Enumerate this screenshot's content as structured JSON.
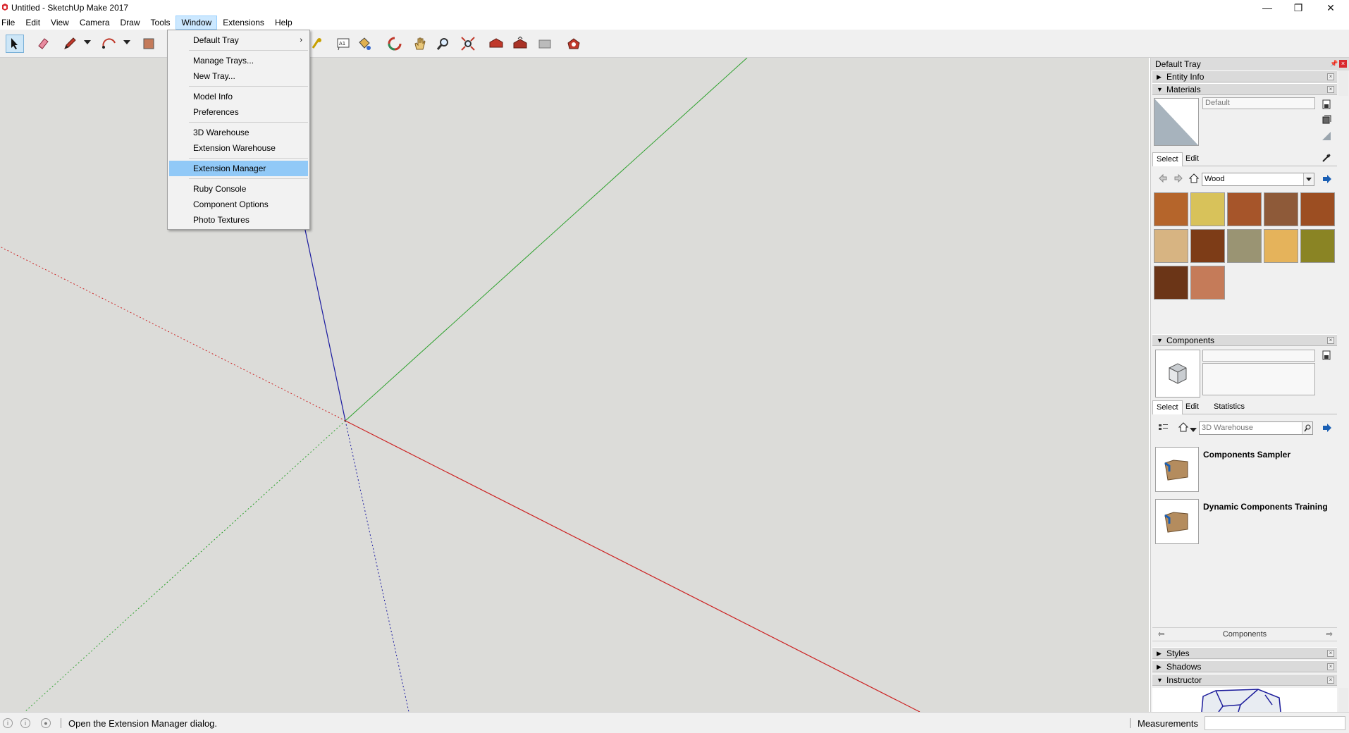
{
  "window": {
    "title": "Untitled - SketchUp Make 2017",
    "controls": {
      "minimize": "—",
      "restore": "❐",
      "close": "✕"
    }
  },
  "menubar": {
    "items": [
      "File",
      "Edit",
      "View",
      "Camera",
      "Draw",
      "Tools",
      "Window",
      "Extensions",
      "Help"
    ],
    "active": "Window"
  },
  "window_menu": {
    "items": [
      {
        "label": "Default Tray",
        "submenu_arrow": "›"
      },
      {
        "label": "Manage Trays..."
      },
      {
        "label": "New Tray..."
      },
      {
        "label": "Model Info"
      },
      {
        "label": "Preferences"
      },
      {
        "label": "3D Warehouse"
      },
      {
        "label": "Extension Warehouse"
      },
      {
        "label": "Extension Manager",
        "highlighted": true
      },
      {
        "label": "Ruby Console"
      },
      {
        "label": "Component Options"
      },
      {
        "label": "Photo Textures"
      }
    ]
  },
  "toolbar": {
    "tools": [
      "select-tool",
      "eraser-tool",
      "line-tool",
      "arc-tool",
      "shape-tool",
      "tape-measure-tool",
      "text-tool",
      "paint-bucket-tool",
      "orbit-tool",
      "pan-tool",
      "zoom-tool",
      "zoom-extents-tool",
      "warehouse-tool",
      "share-model-tool",
      "extension-warehouse-tool",
      "extension-manager-tool"
    ],
    "text_tool_glyph": "A1"
  },
  "tray": {
    "title": "Default Tray",
    "pin_glyph": "📌",
    "close_glyph": "×",
    "panel_close_glyph": "×",
    "tri_open": "▼",
    "tri_closed": "▶",
    "panels": {
      "entity_info": "Entity Info",
      "materials": "Materials",
      "components": "Components",
      "styles": "Styles",
      "shadows": "Shadows",
      "instructor": "Instructor"
    },
    "materials": {
      "current_name": "Default",
      "tabs": [
        "Select",
        "Edit"
      ],
      "active_tab": "Select",
      "library": "Wood",
      "swatch_colors": [
        "#b5652b",
        "#d8c25a",
        "#a6552a",
        "#8e5a39",
        "#9c4e22",
        "#d7b482",
        "#7d3c17",
        "#9a9473",
        "#e5b35b",
        "#8a8424",
        "#6b3517",
        "#c57b59"
      ]
    },
    "components": {
      "tabs": [
        "Select",
        "Edit",
        "Statistics"
      ],
      "active_tab": "Select",
      "search_placeholder": "3D Warehouse",
      "items": [
        "Components Sampler",
        "Dynamic Components Training"
      ],
      "footer": "Components"
    }
  },
  "statusbar": {
    "message": "Open the Extension Manager dialog.",
    "measurements_label": "Measurements",
    "icons": [
      "i",
      "i",
      "●"
    ]
  }
}
